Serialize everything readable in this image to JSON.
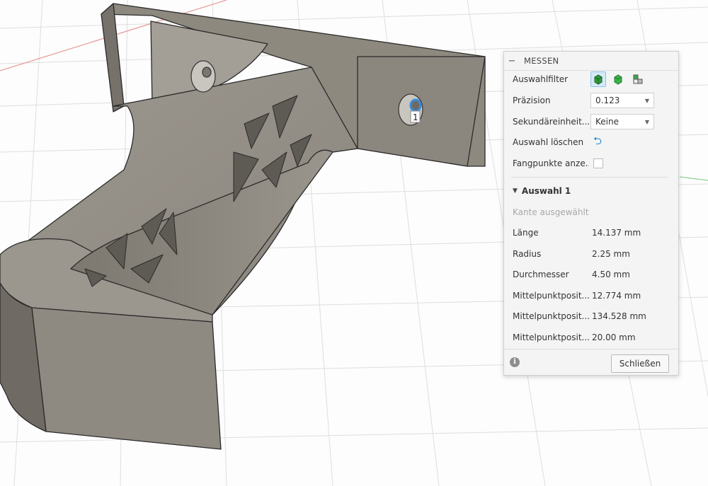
{
  "panel": {
    "title": "MESSEN",
    "collapse_glyph": "−",
    "rows": {
      "filter_label": "Auswahlfilter",
      "filter_icons": [
        "select-body-icon",
        "select-face-icon",
        "select-component-icon"
      ],
      "precision_label": "Präzision",
      "precision_value": "0.123",
      "secondary_label": "Sekundäreinheit...",
      "secondary_value": "Keine",
      "clear_label": "Auswahl löschen",
      "snap_label": "Fangpunkte anze..."
    },
    "selection": {
      "header": "Auswahl 1",
      "subtitle": "Kante ausgewählt",
      "measurements": [
        {
          "label": "Länge",
          "value": "14.137 mm"
        },
        {
          "label": "Radius",
          "value": "2.25 mm"
        },
        {
          "label": "Durchmesser",
          "value": "4.50 mm"
        },
        {
          "label": "Mittelpunktposit...",
          "value": "12.774 mm"
        },
        {
          "label": "Mittelpunktposit...",
          "value": "134.528 mm"
        },
        {
          "label": "Mittelpunktposit...",
          "value": "20.00 mm"
        }
      ]
    },
    "close_button": "Schließen",
    "info_glyph": "i"
  },
  "viewport": {
    "selection_marker": "1",
    "colors": {
      "body": "#8f8a82",
      "highlight": "#3a8de0",
      "grid": "#d9d9d9"
    }
  }
}
